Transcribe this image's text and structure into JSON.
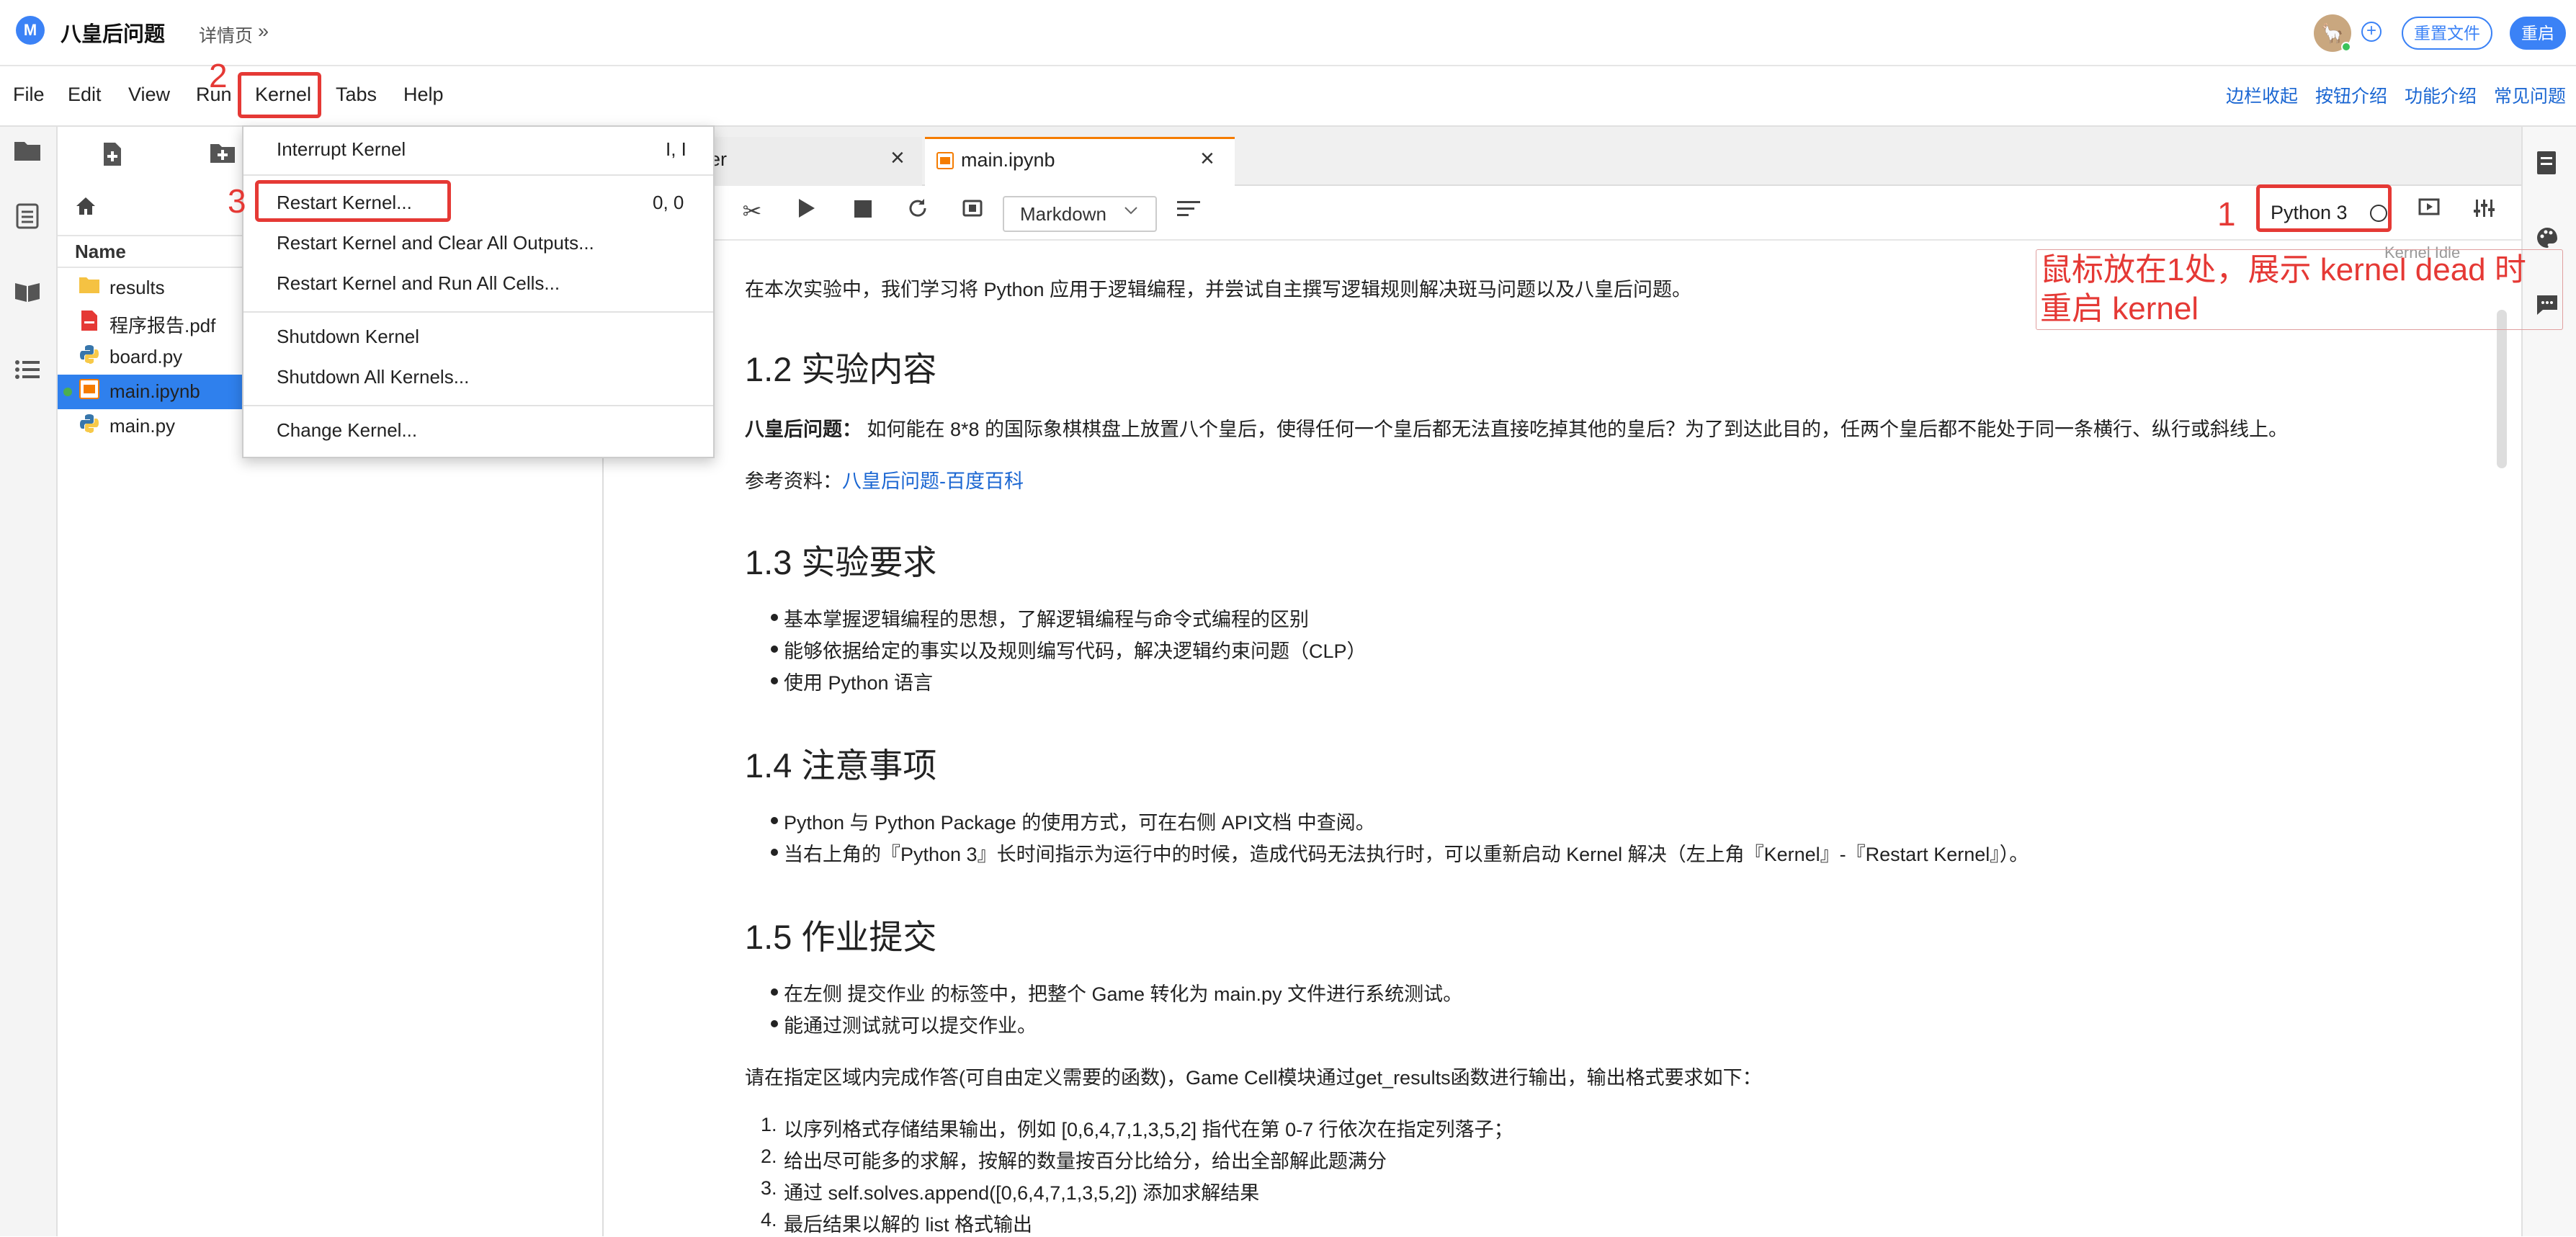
{
  "app": {
    "title": "八皇后问题",
    "detail_link": "详情页",
    "detail_chevron": "»",
    "reset_file_label": "重置文件",
    "restart_label": "重启",
    "avatar_glyph": "🦙"
  },
  "menubar": {
    "items": [
      "File",
      "Edit",
      "View",
      "Run",
      "Kernel",
      "Tabs",
      "Help"
    ],
    "right_links": [
      "边栏收起",
      "按钮介绍",
      "功能介绍",
      "常见问题"
    ]
  },
  "filebrowser": {
    "name_header": "Name",
    "files": [
      {
        "name": "results",
        "icon": "folder-icon",
        "selected": false
      },
      {
        "name": "程序报告.pdf",
        "icon": "pdf-icon",
        "selected": false
      },
      {
        "name": "board.py",
        "icon": "python-icon",
        "selected": false
      },
      {
        "name": "main.ipynb",
        "icon": "notebook-icon",
        "selected": true
      },
      {
        "name": "main.py",
        "icon": "python-icon",
        "selected": false
      }
    ]
  },
  "tabs": {
    "prev_label": "ner",
    "main_label": "main.ipynb"
  },
  "toolbar": {
    "cell_type": "Markdown",
    "kernel_name": "Python 3",
    "kernel_status_tip": "Kernel Idle"
  },
  "kernel_menu": {
    "interrupt": {
      "label": "Interrupt Kernel",
      "shortcut": "I, I"
    },
    "restart": {
      "label": "Restart Kernel...",
      "shortcut": "0, 0"
    },
    "restart_clear": "Restart Kernel and Clear All Outputs...",
    "restart_run": "Restart Kernel and Run All Cells...",
    "shutdown": "Shutdown Kernel",
    "shutdown_all": "Shutdown All Kernels...",
    "change": "Change Kernel..."
  },
  "content": {
    "intro": "在本次实验中，我们学习将 Python 应用于逻辑编程，并尝试自主撰写逻辑规则解决斑马问题以及八皇后问题。",
    "h_12": "1.2 实验内容",
    "problem_label": "八皇后问题：",
    "problem_text": " 如何能在 8*8 的国际象棋棋盘上放置八个皇后，使得任何一个皇后都无法直接吃掉其他的皇后？为了到达此目的，任两个皇后都不能处于同一条横行、纵行或斜线上。",
    "ref_label": "参考资料：",
    "ref_link": "八皇后问题-百度百科",
    "h_13": "1.3 实验要求",
    "req": [
      "基本掌握逻辑编程的思想，了解逻辑编程与命令式编程的区别",
      "能够依据给定的事实以及规则编写代码，解决逻辑约束问题（CLP）",
      "使用 Python 语言"
    ],
    "h_14": "1.4 注意事项",
    "notes": [
      "Python 与 Python Package 的使用方式，可在右侧 API文档 中查阅。",
      "当右上角的『Python 3』长时间指示为运行中的时候，造成代码无法执行时，可以重新启动 Kernel 解决（左上角『Kernel』-『Restart Kernel』）。"
    ],
    "h_15": "1.5 作业提交",
    "submit": [
      "在左侧 提交作业 的标签中，把整个 Game 转化为 main.py 文件进行系统测试。",
      "能通过测试就可以提交作业。"
    ],
    "instr": "请在指定区域内完成作答(可自由定义需要的函数)，Game Cell模块通过get_results函数进行输出，输出格式要求如下：",
    "ol": [
      "以序列格式存储结果输出，例如 [0,6,4,7,1,3,5,2] 指代在第 0-7 行依次在指定列落子；",
      "给出尽可能多的求解，按解的数量按百分比给分，给出全部解此题满分",
      "通过 self.solves.append([0,6,4,7,1,3,5,2]) 添加求解结果",
      "最后结果以解的 list 格式输出"
    ],
    "ol_nums": [
      "1.",
      "2.",
      "3.",
      "4."
    ]
  },
  "annotations": {
    "num1": "1",
    "num2": "2",
    "num3": "3",
    "note_line1": "鼠标放在1处，展示 kernel dead 时",
    "note_line2": "重启 kernel"
  },
  "colors": {
    "accent": "#3b82f6",
    "annotation_red": "#e53935",
    "selected_row": "#2f80ed",
    "tab_marker": "#f57c00",
    "link": "#1a66d2"
  }
}
